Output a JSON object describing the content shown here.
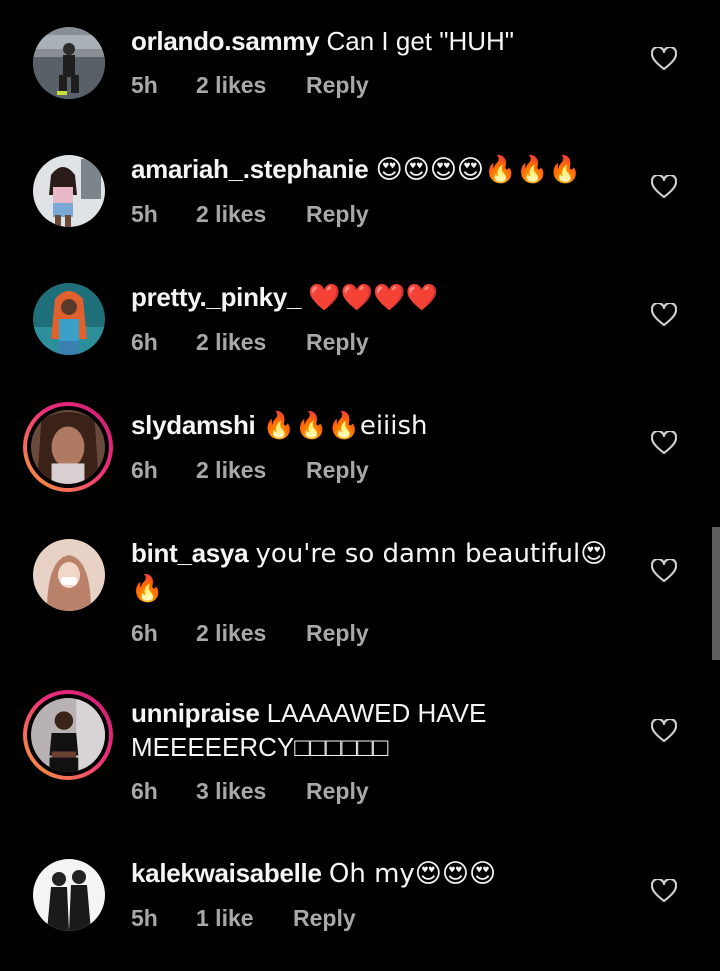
{
  "comments": [
    {
      "username": "orlando.sammy",
      "text": "Can I get \"HUH\"",
      "time": "5h",
      "likes": "2 likes",
      "reply": "Reply",
      "avatar_story_ring": false
    },
    {
      "username": "amariah_.stephanie",
      "text": "😍😍😍😍🔥🔥🔥",
      "time": "5h",
      "likes": "2 likes",
      "reply": "Reply",
      "avatar_story_ring": false
    },
    {
      "username": "pretty._pinky_",
      "text": "❤️❤️❤️❤️",
      "time": "6h",
      "likes": "2 likes",
      "reply": "Reply",
      "avatar_story_ring": false
    },
    {
      "username": "slydamshi",
      "text": "🔥🔥🔥eiiish",
      "time": "6h",
      "likes": "2 likes",
      "reply": "Reply",
      "avatar_story_ring": true
    },
    {
      "username": "bint_asya",
      "text": "you're so damn beautiful😍",
      "text_line2": "🔥",
      "time": "6h",
      "likes": "2 likes",
      "reply": "Reply",
      "avatar_story_ring": false
    },
    {
      "username": "unnipraise",
      "text": "LAAAAWED HAVE",
      "text_line2": "MEEEEERCY□□□□□□",
      "time": "6h",
      "likes": "3 likes",
      "reply": "Reply",
      "avatar_story_ring": true
    },
    {
      "username": "kalekwaisabelle",
      "text": "Oh my😍😍😍",
      "time": "5h",
      "likes": "1 like",
      "reply": "Reply",
      "avatar_story_ring": false
    }
  ],
  "icons": {
    "like": "heart-outline-icon"
  },
  "colors": {
    "background": "#000000",
    "text": "#f5f5f5",
    "meta": "#a8a8a8",
    "story_ring_start": "#f9a23a",
    "story_ring_end": "#c81d77"
  }
}
